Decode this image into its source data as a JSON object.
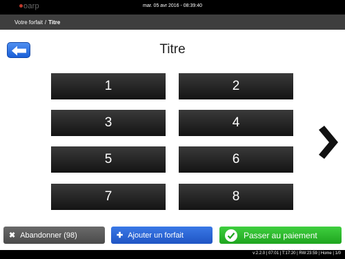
{
  "header": {
    "logo_text": "oarp",
    "datetime": "mar. 05 avr 2016 - 08:39:40"
  },
  "breadcrumb": {
    "parent": "Votre forfait",
    "separator": "/",
    "current": "Titre"
  },
  "page": {
    "title": "Titre",
    "back_icon": "arrow-left-icon",
    "next_icon": "chevron-right-icon"
  },
  "grid": {
    "buttons": [
      "1",
      "2",
      "3",
      "4",
      "5",
      "6",
      "7",
      "8"
    ]
  },
  "actions": {
    "cancel_label": "Abandonner (98)",
    "add_label": "Ajouter un forfait",
    "pay_label": "Passer au paiement",
    "cancel_icon": "✖",
    "add_icon": "✚",
    "pay_icon": "check-circle-icon"
  },
  "footer": {
    "status": "v:2.2.0 | 07:01 | T:17:20 | RW:23:59 | Home | 1/0"
  },
  "colors": {
    "back_button": "#1a5fd8",
    "add_button": "#1f55c4",
    "pay_button": "#1fa51f",
    "cancel_button": "#4a4a4a"
  }
}
